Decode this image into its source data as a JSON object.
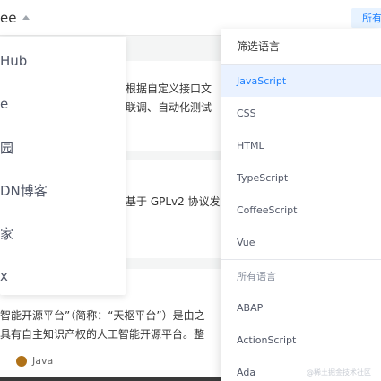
{
  "topbar": {
    "source_select": "ee",
    "lang_trigger": "所有"
  },
  "cards": [
    {
      "line1": "根据自定义接口文",
      "line2": "联调、自动化测试"
    },
    {
      "line1": "基于 GPLv2 协议发"
    },
    {
      "line1": "智能开源平台”（简称：“天枢平台”）是由之",
      "line2": "具有自主知识产权的人工智能开源平台。整",
      "language": "Java"
    }
  ],
  "source_menu": {
    "items": [
      "Hub",
      "e",
      "园",
      "DN博客",
      "家",
      "x"
    ]
  },
  "lang_menu": {
    "title": "筛选语言",
    "selected": "JavaScript",
    "popular": [
      "JavaScript",
      "CSS",
      "HTML",
      "TypeScript",
      "CoffeeScript",
      "Vue"
    ],
    "all_label": "所有语言",
    "all": [
      "ABAP",
      "ActionScript",
      "Ada"
    ]
  },
  "watermark": "@稀土掘金技术社区",
  "colors": {
    "accent": "#1e80ff",
    "java": "#b07219"
  }
}
